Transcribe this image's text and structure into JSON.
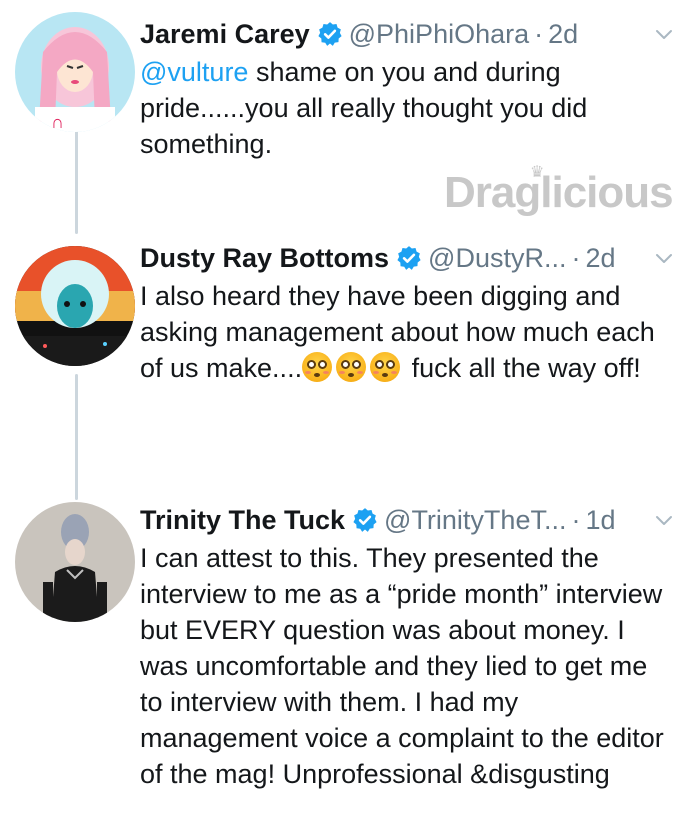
{
  "watermark": "Draglicious",
  "tweets": [
    {
      "name": "Jaremi Carey",
      "handle": "@PhiPhiOhara",
      "time": "2d",
      "mention": "@vulture",
      "text": " shame on you and during pride......you all really thought you did something."
    },
    {
      "name": "Dusty Ray Bottoms",
      "handle": "@DustyR...",
      "time": "2d",
      "text_before": "I also heard they have been digging and asking management about how much each of us make....",
      "emojis": [
        "flushed-face",
        "flushed-face",
        "flushed-face"
      ],
      "text_after": " fuck all the way off!"
    },
    {
      "name": "Trinity The Tuck",
      "handle": "@TrinityTheT...",
      "time": "1d",
      "text": "I can attest to this. They presented the interview to me as a “pride month” interview but EVERY question was about money. I was uncomfortable and they lied to get me to interview with them. I had my management voice a complaint to the editor of the mag! Unprofessional &disgusting"
    }
  ],
  "colors": {
    "accent": "#1da1f2",
    "secondary_text": "#657786",
    "thread_line": "#ccd6dd"
  }
}
